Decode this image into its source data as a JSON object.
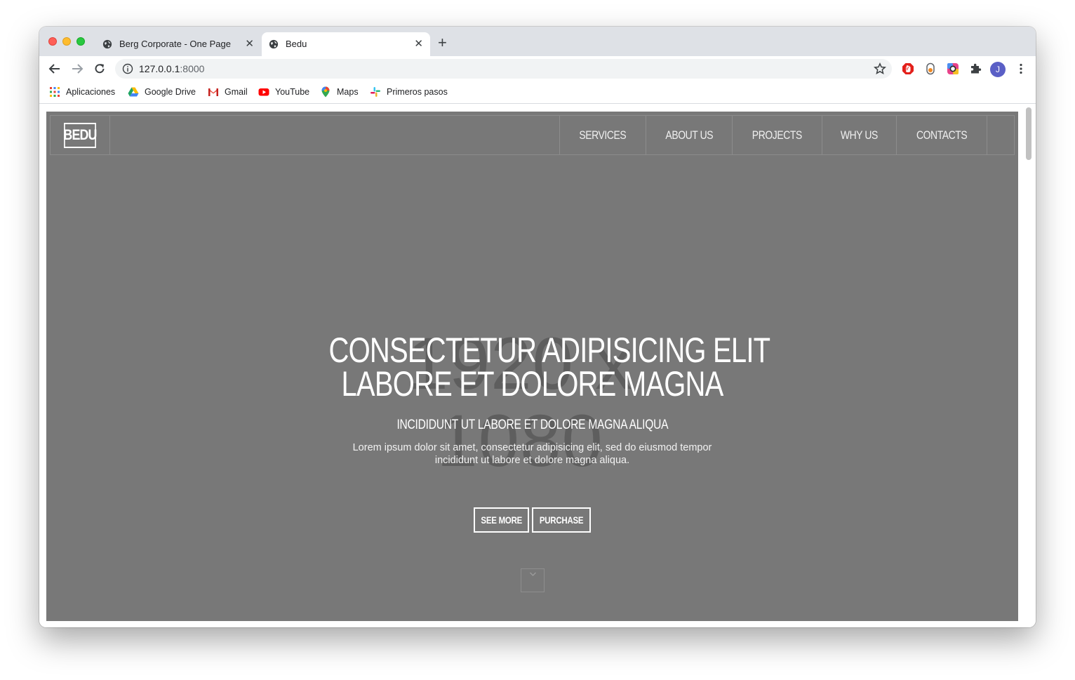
{
  "browser": {
    "tabs": [
      {
        "title": "Berg Corporate - One Page",
        "active": false
      },
      {
        "title": "Bedu",
        "active": true
      }
    ],
    "url_host": "127.0.0.1",
    "url_port": ":8000",
    "bookmarks": [
      {
        "label": "Aplicaciones",
        "icon": "apps-grid-icon"
      },
      {
        "label": "Google Drive",
        "icon": "google-drive-icon"
      },
      {
        "label": "Gmail",
        "icon": "gmail-icon"
      },
      {
        "label": "YouTube",
        "icon": "youtube-icon"
      },
      {
        "label": "Maps",
        "icon": "maps-icon"
      },
      {
        "label": "Primeros pasos",
        "icon": "slack-icon"
      }
    ],
    "avatar_initial": "J"
  },
  "site": {
    "logo": "BEDU",
    "nav": [
      "SERVICES",
      "ABOUT US",
      "PROJECTS",
      "WHY US",
      "CONTACTS"
    ],
    "hero": {
      "placeholder_text": "1920 x 1080",
      "title_line1": "CONSECTETUR ADIPISICING ELIT",
      "title_line2": "LABORE ET DOLORE MAGNA",
      "subtitle": "INCIDIDUNT UT LABORE ET DOLORE MAGNA ALIQUA",
      "text": "Lorem ipsum dolor sit amet, consectetur adipisicing elit, sed do eiusmod tempor incididunt ut labore et dolore magna aliqua.",
      "button_see_more": "SEE MORE",
      "button_purchase": "PURCHASE"
    },
    "colors": {
      "hero_bg": "#787878",
      "placeholder_text": "#5c5c5c",
      "border": "#8c8c8c"
    }
  }
}
